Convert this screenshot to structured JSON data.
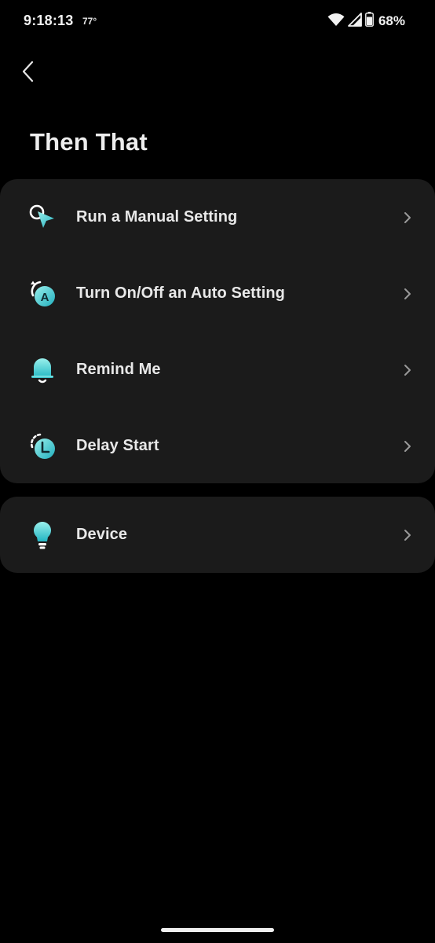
{
  "status_bar": {
    "time": "9:18:13",
    "temperature": "77°",
    "battery": "68%",
    "icons": [
      "wifi-icon",
      "cell-signal-icon",
      "battery-icon"
    ]
  },
  "header": {
    "back_icon": "chevron-left-icon",
    "title": "Then That"
  },
  "actions": [
    {
      "label": "Run a Manual Setting",
      "icon": "manual-setting-icon"
    },
    {
      "label": "Turn On/Off an Auto Setting",
      "icon": "auto-setting-icon"
    },
    {
      "label": "Remind Me",
      "icon": "bell-icon"
    },
    {
      "label": "Delay Start",
      "icon": "delay-clock-icon"
    }
  ],
  "device": {
    "label": "Device",
    "icon": "lightbulb-icon"
  },
  "colors": {
    "background": "#000000",
    "card": "#1b1b1b",
    "accent_light": "#7ce6e6",
    "accent_dark": "#2bb8c4",
    "text": "#e8e8e8",
    "chevron": "#9a9a9a"
  }
}
